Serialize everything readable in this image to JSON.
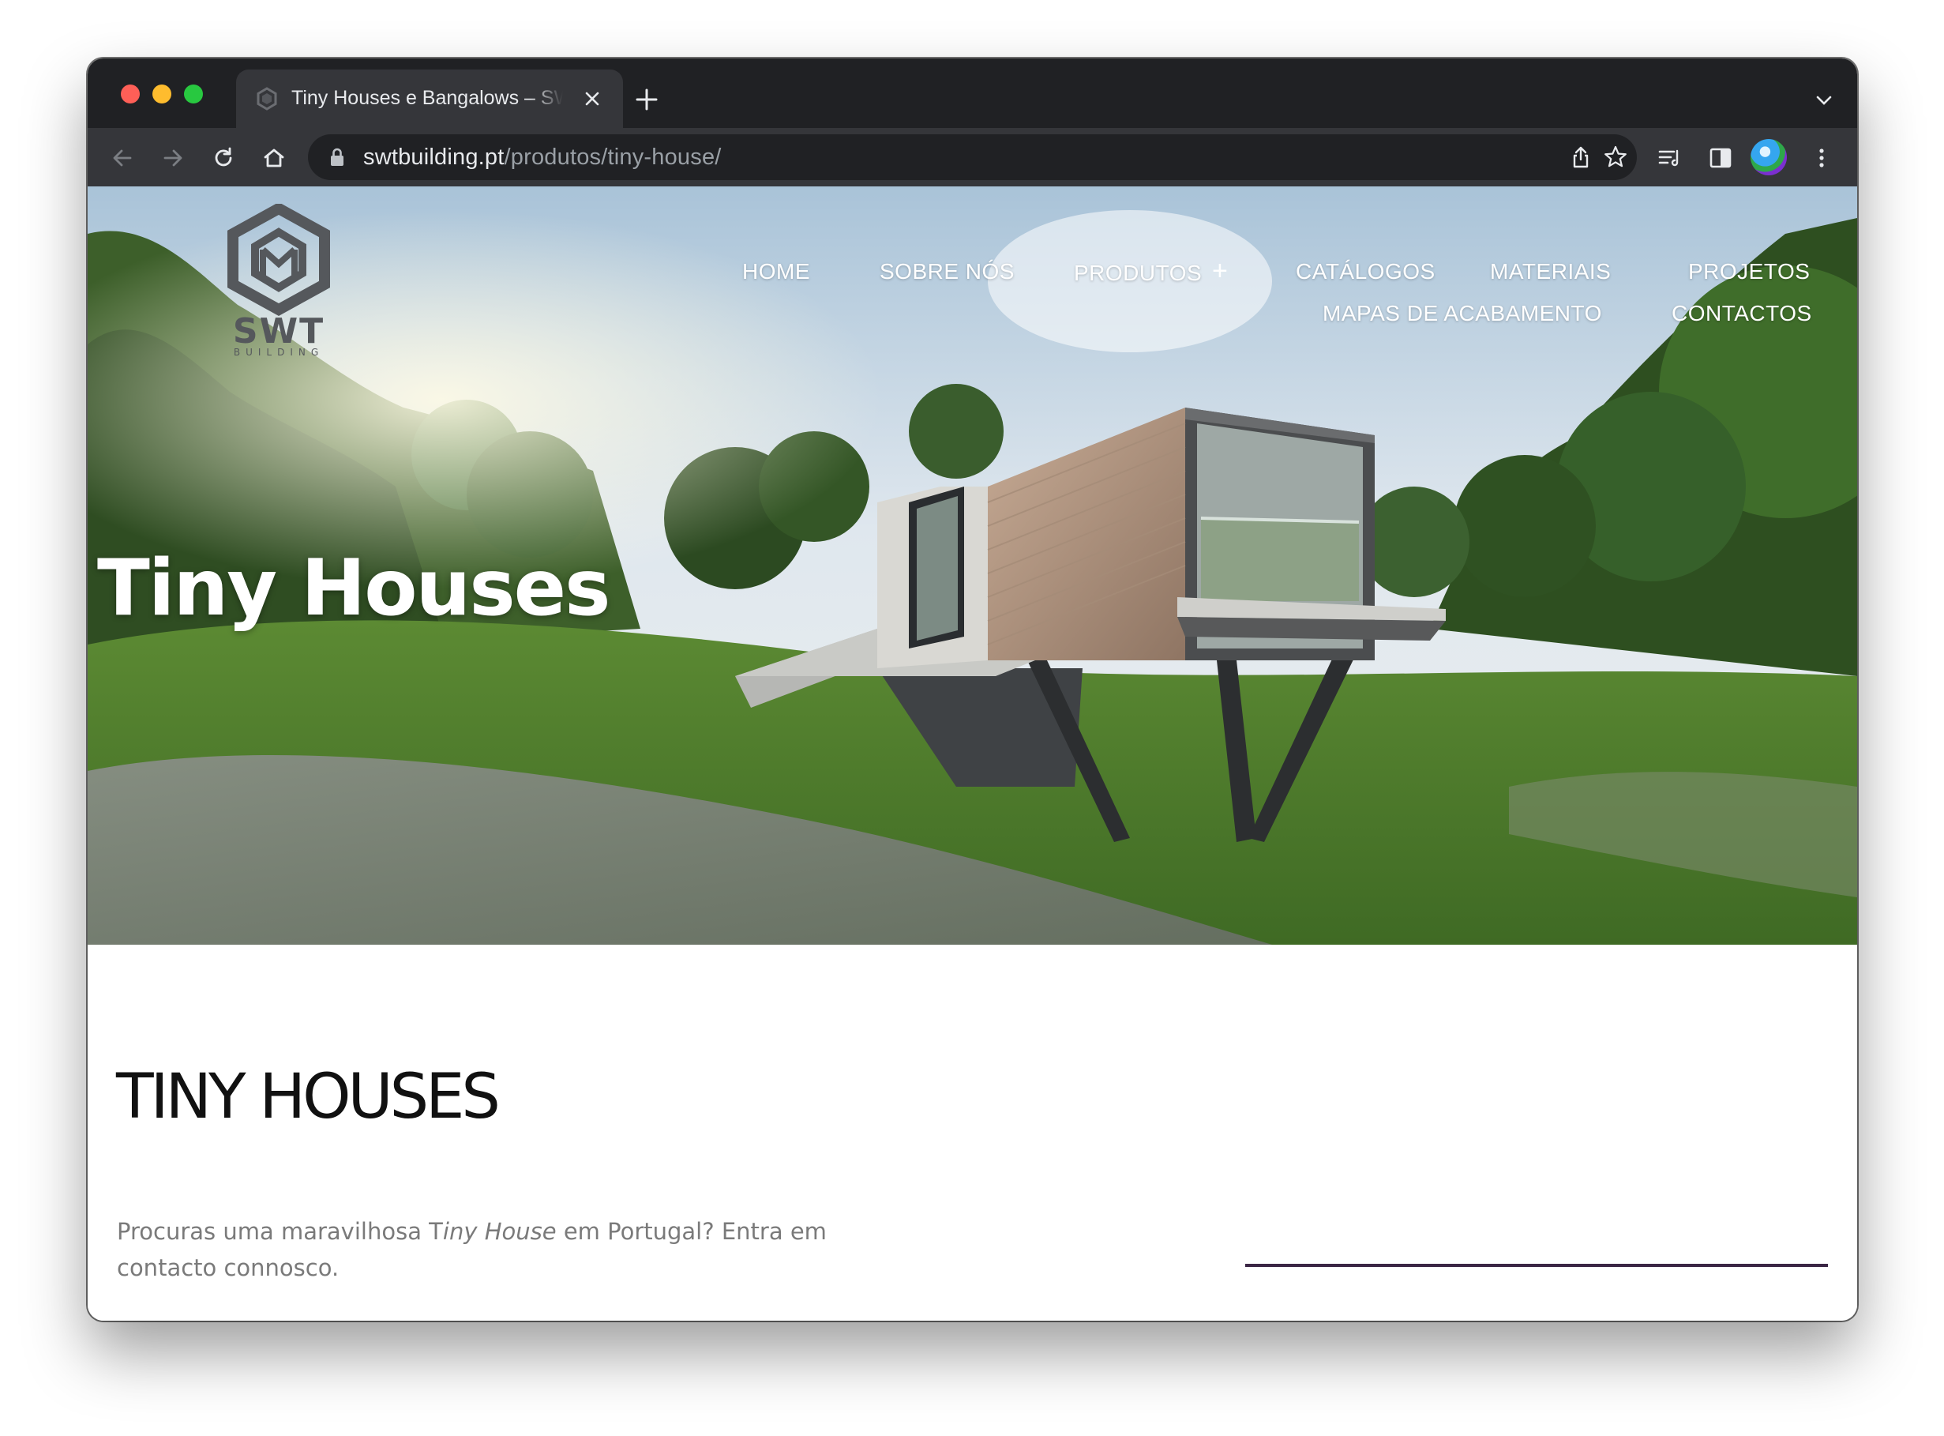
{
  "browser": {
    "tab": {
      "title": "Tiny Houses e Bangalows – SWT Building"
    },
    "address_bar": {
      "host": "swtbuilding.pt",
      "path": "/produtos/tiny-house/"
    },
    "icons": [
      "back-arrow-icon",
      "forward-arrow-icon",
      "reload-icon",
      "home-icon",
      "lock-icon",
      "share-icon",
      "bookmark-star-icon",
      "reading-list-icon",
      "side-panel-icon",
      "profile-avatar",
      "more-vert-icon"
    ]
  },
  "site": {
    "logo": {
      "text": "SWT",
      "subtext": "BUILDING"
    },
    "nav": {
      "home": "HOME",
      "about": "SOBRE NÓS",
      "products": "PRODUTOS",
      "products_expand": "+",
      "catalogs": "CATÁLOGOS",
      "materials": "MATERIAIS",
      "projects": "PROJETOS",
      "finish_maps": "MAPAS DE ACABAMENTO",
      "contacts": "CONTACTOS"
    },
    "hero": {
      "title": "Tiny Houses"
    },
    "section": {
      "title": "TINY HOUSES",
      "text_before": "Procuras uma maravilhosa T",
      "text_italic": "iny House",
      "text_after": " em Portugal? Entra em contacto connosco."
    }
  },
  "colors": {
    "chrome_dark": "#202124",
    "chrome_tab": "#35363a",
    "accent_line": "#3b2645",
    "body_text": "#7a7a7a"
  }
}
